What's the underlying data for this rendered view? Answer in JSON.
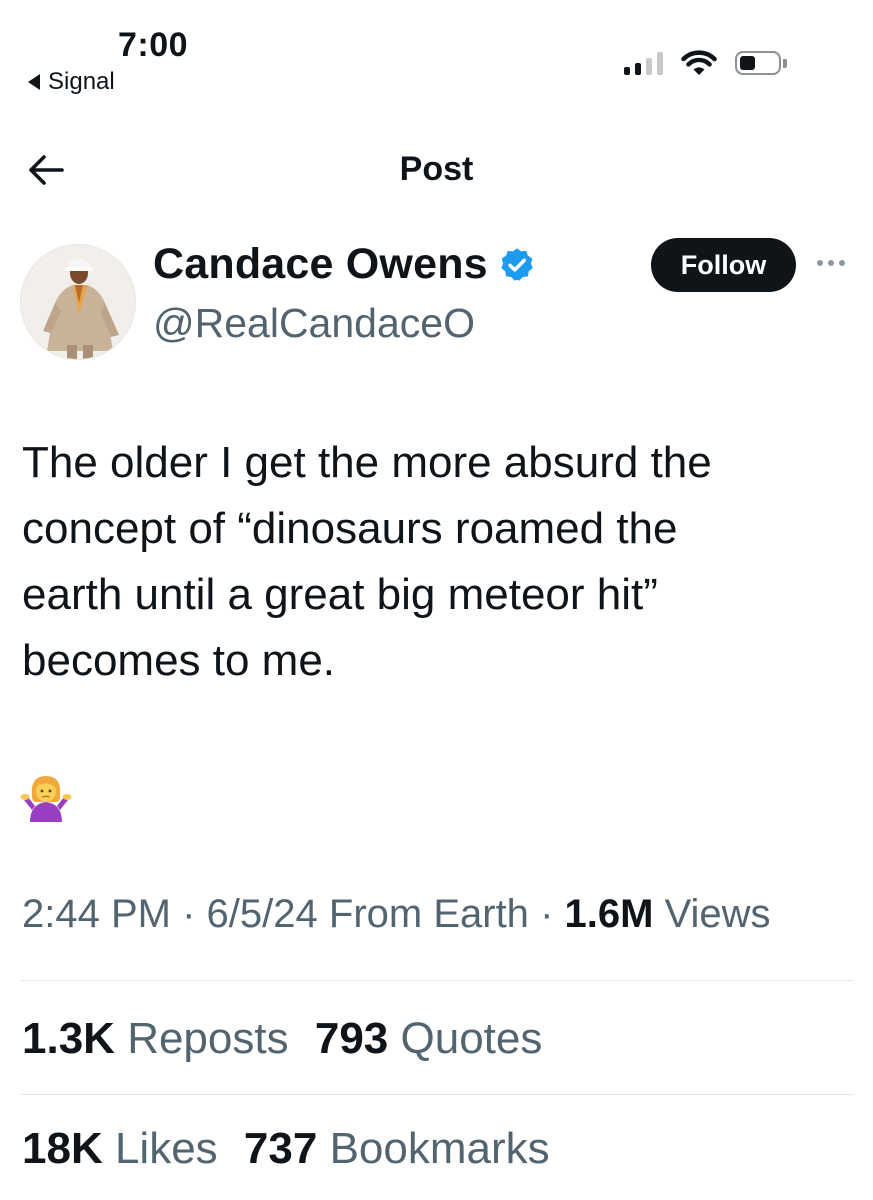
{
  "status_bar": {
    "time": "7:00",
    "back_app": "Signal",
    "icons": [
      "cellular-signal-icon",
      "wifi-icon",
      "battery-icon"
    ]
  },
  "nav": {
    "title": "Post",
    "back_icon": "arrow-left-icon"
  },
  "author": {
    "display_name": "Candace Owens",
    "handle": "@RealCandaceO",
    "verified_icon": "verified-badge-icon",
    "follow_label": "Follow",
    "more_icon": "ellipsis-icon"
  },
  "tweet": {
    "lines": [
      "The older I get the more absurd the",
      "concept of “dinosaurs roamed the",
      "earth until a great big meteor hit”",
      "becomes to me."
    ],
    "emoji": "person-shrugging-emoji"
  },
  "meta": {
    "time": "2:44 PM",
    "sep1": "·",
    "date": "6/5/24",
    "source": "From Earth",
    "sep2": "·",
    "views_count": "1.6M",
    "views_label": "Views"
  },
  "stats": {
    "reposts_count": "1.3K",
    "reposts_label": "Reposts",
    "quotes_count": "793",
    "quotes_label": "Quotes",
    "likes_count": "18K",
    "likes_label": "Likes",
    "bookmarks_count": "737",
    "bookmarks_label": "Bookmarks"
  },
  "colors": {
    "text": "#0f1419",
    "secondary": "#536471",
    "verified_blue": "#1d9bf0",
    "follow_bg": "#0f1419",
    "divider": "#e1e6ea"
  }
}
